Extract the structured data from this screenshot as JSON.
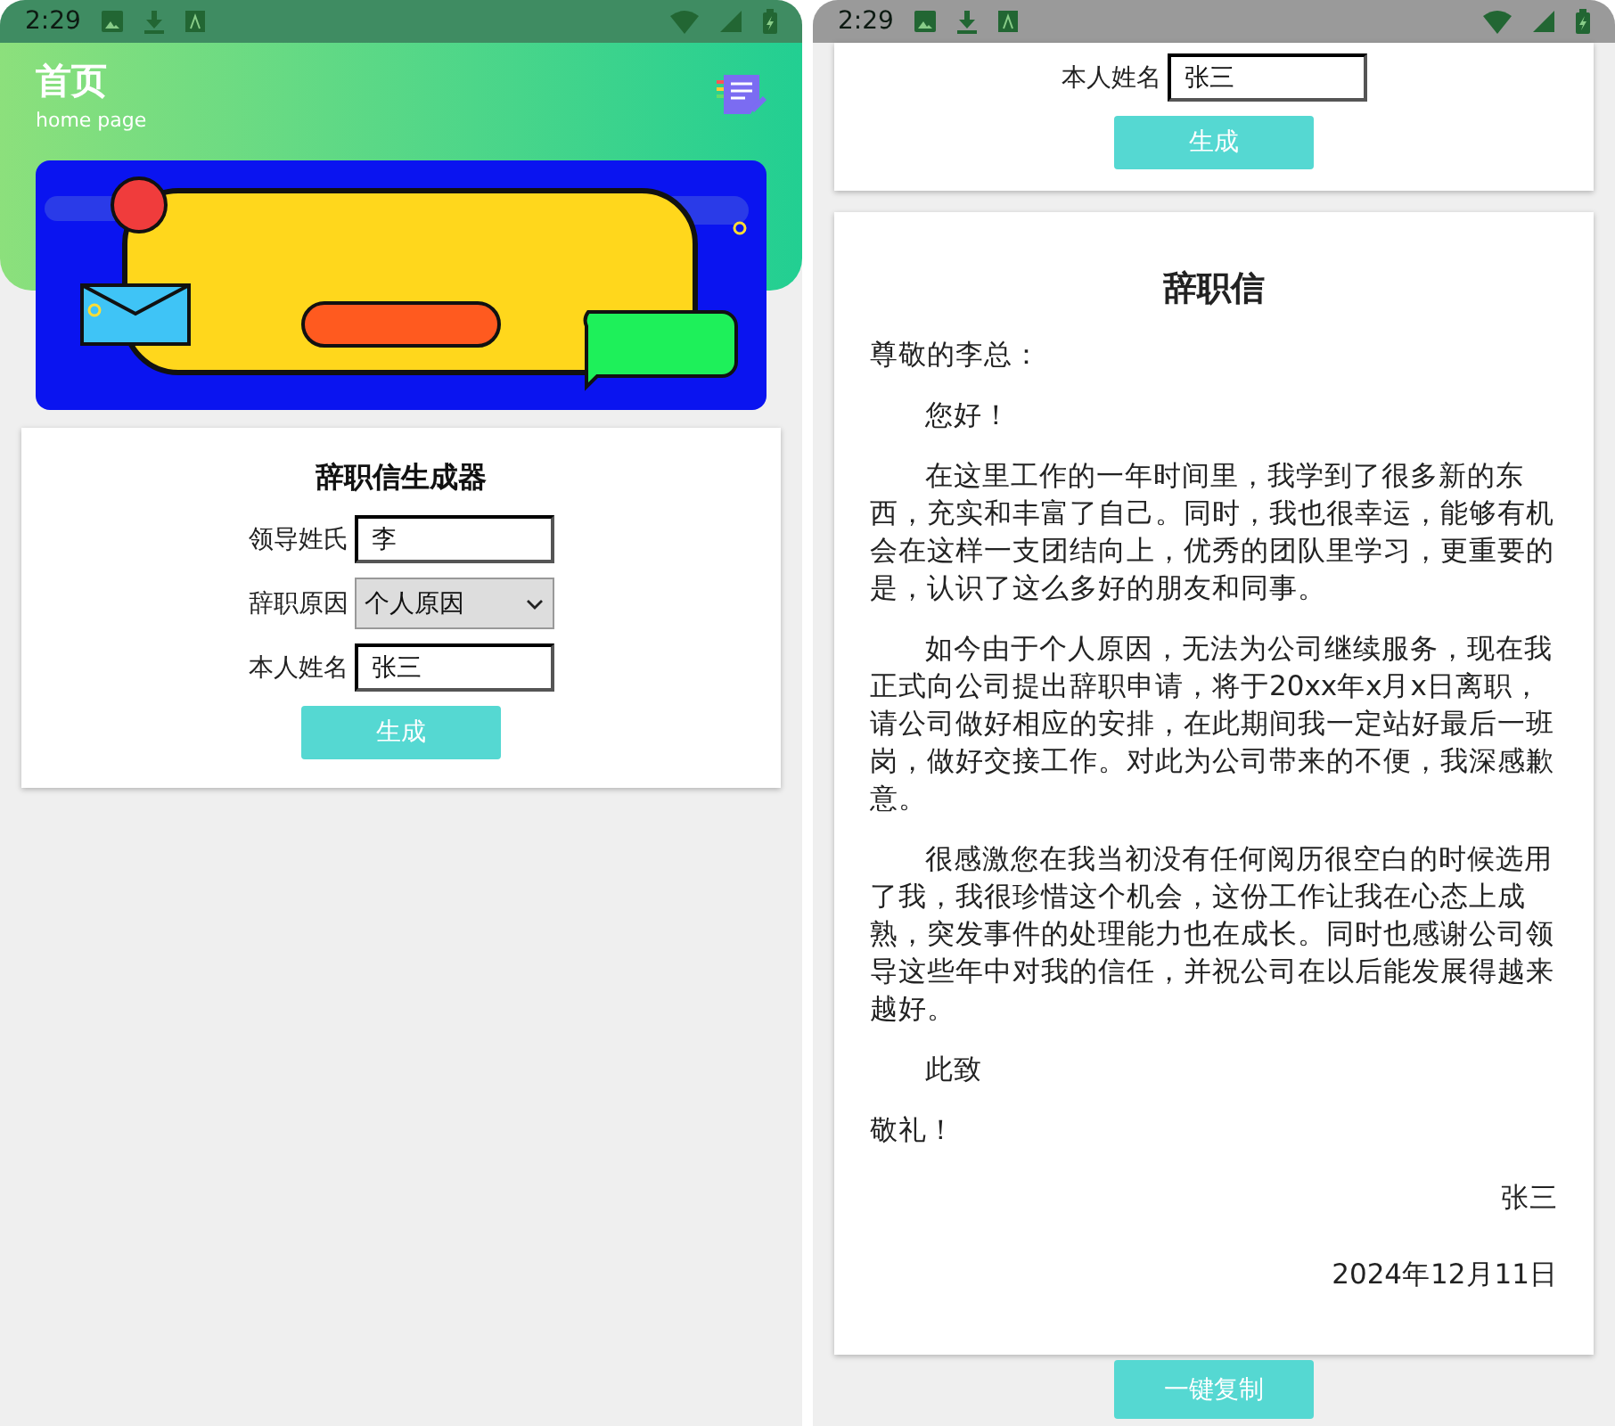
{
  "left": {
    "status_bar": {
      "time": "2:29"
    },
    "header": {
      "title": "首页",
      "subtitle": "home page"
    },
    "form": {
      "title": "辞职信生成器",
      "fields": [
        {
          "kind": "text",
          "label": "领导姓氏",
          "value": "李"
        },
        {
          "kind": "select",
          "label": "辞职原因",
          "value": "个人原因"
        },
        {
          "kind": "text",
          "label": "本人姓名",
          "value": "张三"
        }
      ],
      "button": "生成"
    }
  },
  "right": {
    "status_bar": {
      "time": "2:29"
    },
    "form": {
      "fields": [
        {
          "kind": "text",
          "label": "本人姓名",
          "value": "张三"
        }
      ],
      "button": "生成"
    },
    "letter": {
      "title": "辞职信",
      "lines": [
        {
          "kind": "plain",
          "text": "尊敬的李总："
        },
        {
          "kind": "indent",
          "text": "您好！"
        },
        {
          "kind": "indent",
          "text": "在这里工作的一年时间里，我学到了很多新的东西，充实和丰富了自己。同时，我也很幸运，能够有机会在这样一支团结向上，优秀的团队里学习，更重要的是，认识了这么多好的朋友和同事。"
        },
        {
          "kind": "indent",
          "text": "如今由于个人原因，无法为公司继续服务，现在我正式向公司提出辞职申请，将于20xx年x月x日离职，请公司做好相应的安排，在此期间我一定站好最后一班岗，做好交接工作。对此为公司带来的不便，我深感歉意。"
        },
        {
          "kind": "indent",
          "text": "很感激您在我当初没有任何阅历很空白的时候选用了我，我很珍惜这个机会，这份工作让我在心态上成熟，突发事件的处理能力也在成长。同时也感谢公司领导这些年中对我的信任，并祝公司在以后能发展得越来越好。"
        },
        {
          "kind": "indent",
          "text": "此致"
        },
        {
          "kind": "plain",
          "text": "敬礼！"
        },
        {
          "kind": "right",
          "text": "张三"
        },
        {
          "kind": "right",
          "text": "2024年12月11日"
        }
      ]
    },
    "copy_button": "一键复制"
  }
}
